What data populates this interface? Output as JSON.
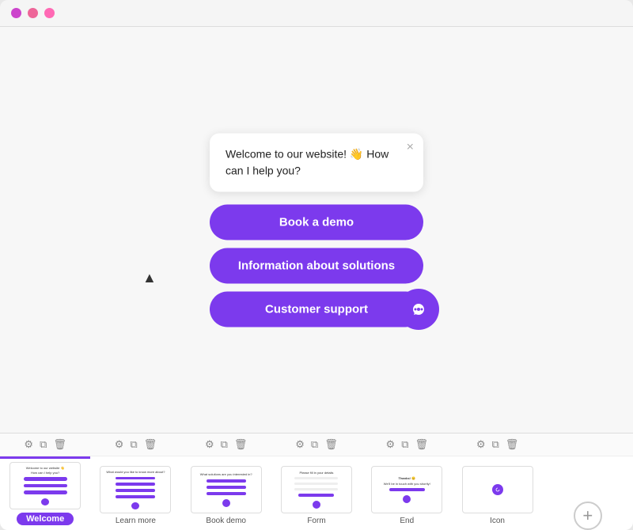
{
  "titleBar": {
    "trafficLights": [
      {
        "color": "#cc44cc",
        "name": "close"
      },
      {
        "color": "#ee6699",
        "name": "minimize"
      },
      {
        "color": "#ff69b4",
        "name": "maximize"
      }
    ]
  },
  "chatWidget": {
    "bubbleText": "Welcome to our website! 👋 How can I help you?",
    "closeLabel": "×",
    "buttons": [
      {
        "label": "Book a demo",
        "id": "book-demo"
      },
      {
        "label": "Information about solutions",
        "id": "info-solutions"
      },
      {
        "label": "Customer support",
        "id": "customer-support"
      }
    ]
  },
  "slides": [
    {
      "label": "Welcome",
      "active": true
    },
    {
      "label": "Learn more",
      "active": false
    },
    {
      "label": "Book demo",
      "active": false
    },
    {
      "label": "Form",
      "active": false
    },
    {
      "label": "End",
      "active": false
    },
    {
      "label": "Icon",
      "active": false
    }
  ],
  "addSlide": {
    "label": "+"
  }
}
